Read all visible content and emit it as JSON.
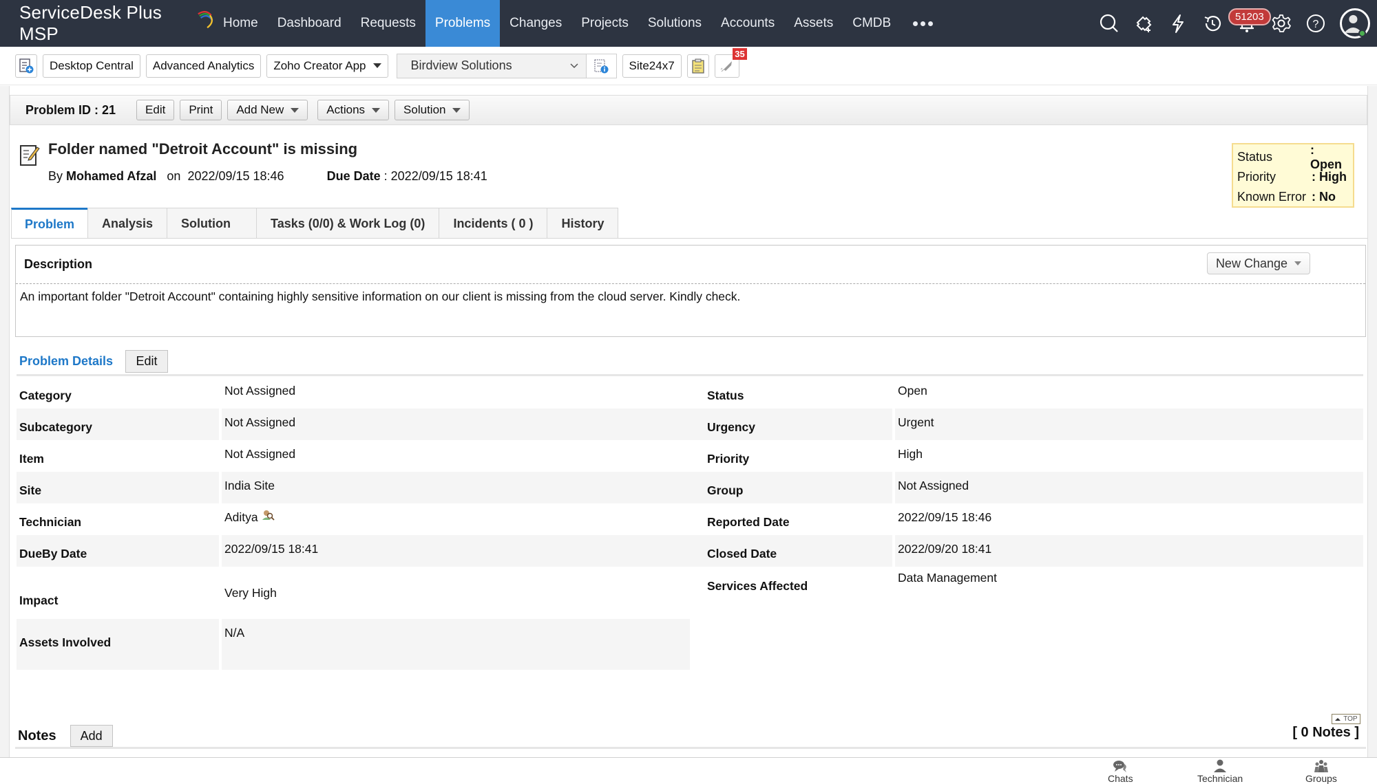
{
  "app": {
    "brand": "ServiceDesk Plus MSP"
  },
  "nav": {
    "items": [
      {
        "label": "Home",
        "active": false
      },
      {
        "label": "Dashboard",
        "active": false
      },
      {
        "label": "Requests",
        "active": false
      },
      {
        "label": "Problems",
        "active": true
      },
      {
        "label": "Changes",
        "active": false
      },
      {
        "label": "Projects",
        "active": false
      },
      {
        "label": "Solutions",
        "active": false
      },
      {
        "label": "Accounts",
        "active": false
      },
      {
        "label": "Assets",
        "active": false
      },
      {
        "label": "CMDB",
        "active": false
      }
    ],
    "more_icon": "more-dots-icon",
    "icons": [
      "search-icon",
      "ticket-add-icon",
      "lightning-icon",
      "history-icon",
      "bell-icon",
      "gear-icon",
      "help-icon",
      "user-avatar-icon"
    ],
    "notification_count": "51203"
  },
  "toolbar": {
    "buttons": [
      "Desktop Central",
      "Advanced Analytics",
      "Zoho Creator App"
    ],
    "account_select": "Birdview Solutions",
    "site_button": "Site24x7",
    "announcement_badge": "35"
  },
  "problem": {
    "id_label": "Problem ID : 21",
    "actions": {
      "edit": "Edit",
      "print": "Print",
      "add_new": "Add New",
      "actions": "Actions",
      "solution": "Solution"
    },
    "title": "Folder named \"Detroit Account\" is missing",
    "by_prefix": "By",
    "author": "Mohamed Afzal",
    "on_label": "on",
    "created": "2022/09/15 18:46",
    "due_label": "Due Date",
    "due_date": "2022/09/15 18:41",
    "summary": [
      {
        "key": "Status",
        "value": ": Open"
      },
      {
        "key": "Priority",
        "value": ": High"
      },
      {
        "key": "Known Error",
        "value": ": No"
      }
    ]
  },
  "tabs": [
    {
      "label": "Problem",
      "active": true
    },
    {
      "label": "Analysis",
      "active": false
    },
    {
      "label": "Solution",
      "active": false
    },
    {
      "label": "Tasks (0/0) & Work Log (0)",
      "active": false
    },
    {
      "label": "Incidents ( 0 )",
      "active": false
    },
    {
      "label": "History",
      "active": false
    }
  ],
  "description": {
    "heading": "Description",
    "new_change": "New Change",
    "text": "An important folder \"Detroit Account\" containing highly sensitive information on our client is missing from the cloud server. Kindly check."
  },
  "details": {
    "heading": "Problem Details",
    "edit": "Edit",
    "left": [
      {
        "label": "Category",
        "value": "Not Assigned"
      },
      {
        "label": "Subcategory",
        "value": "Not Assigned"
      },
      {
        "label": "Item",
        "value": "Not Assigned"
      },
      {
        "label": "Site",
        "value": "India Site"
      },
      {
        "label": "Technician",
        "value": "Aditya"
      },
      {
        "label": "DueBy Date",
        "value": "2022/09/15 18:41"
      },
      {
        "label": "Impact",
        "value": "Very High"
      },
      {
        "label": "Assets Involved",
        "value": "N/A"
      }
    ],
    "right": [
      {
        "label": "Status",
        "value": "Open"
      },
      {
        "label": "Urgency",
        "value": "Urgent"
      },
      {
        "label": "Priority",
        "value": "High"
      },
      {
        "label": "Group",
        "value": "Not Assigned"
      },
      {
        "label": "Reported Date",
        "value": "2022/09/15 18:46"
      },
      {
        "label": "Closed Date",
        "value": "2022/09/20 18:41"
      },
      {
        "label": "Services Affected",
        "value": "Data Management"
      }
    ]
  },
  "notes": {
    "label": "Notes",
    "add": "Add",
    "count": "[ 0 Notes ]",
    "top_link": "TOP"
  },
  "bottom_bar": [
    {
      "label": "Chats",
      "icon": "chat-icon"
    },
    {
      "label": "Technician",
      "icon": "technician-icon"
    },
    {
      "label": "Groups",
      "icon": "groups-icon"
    }
  ]
}
